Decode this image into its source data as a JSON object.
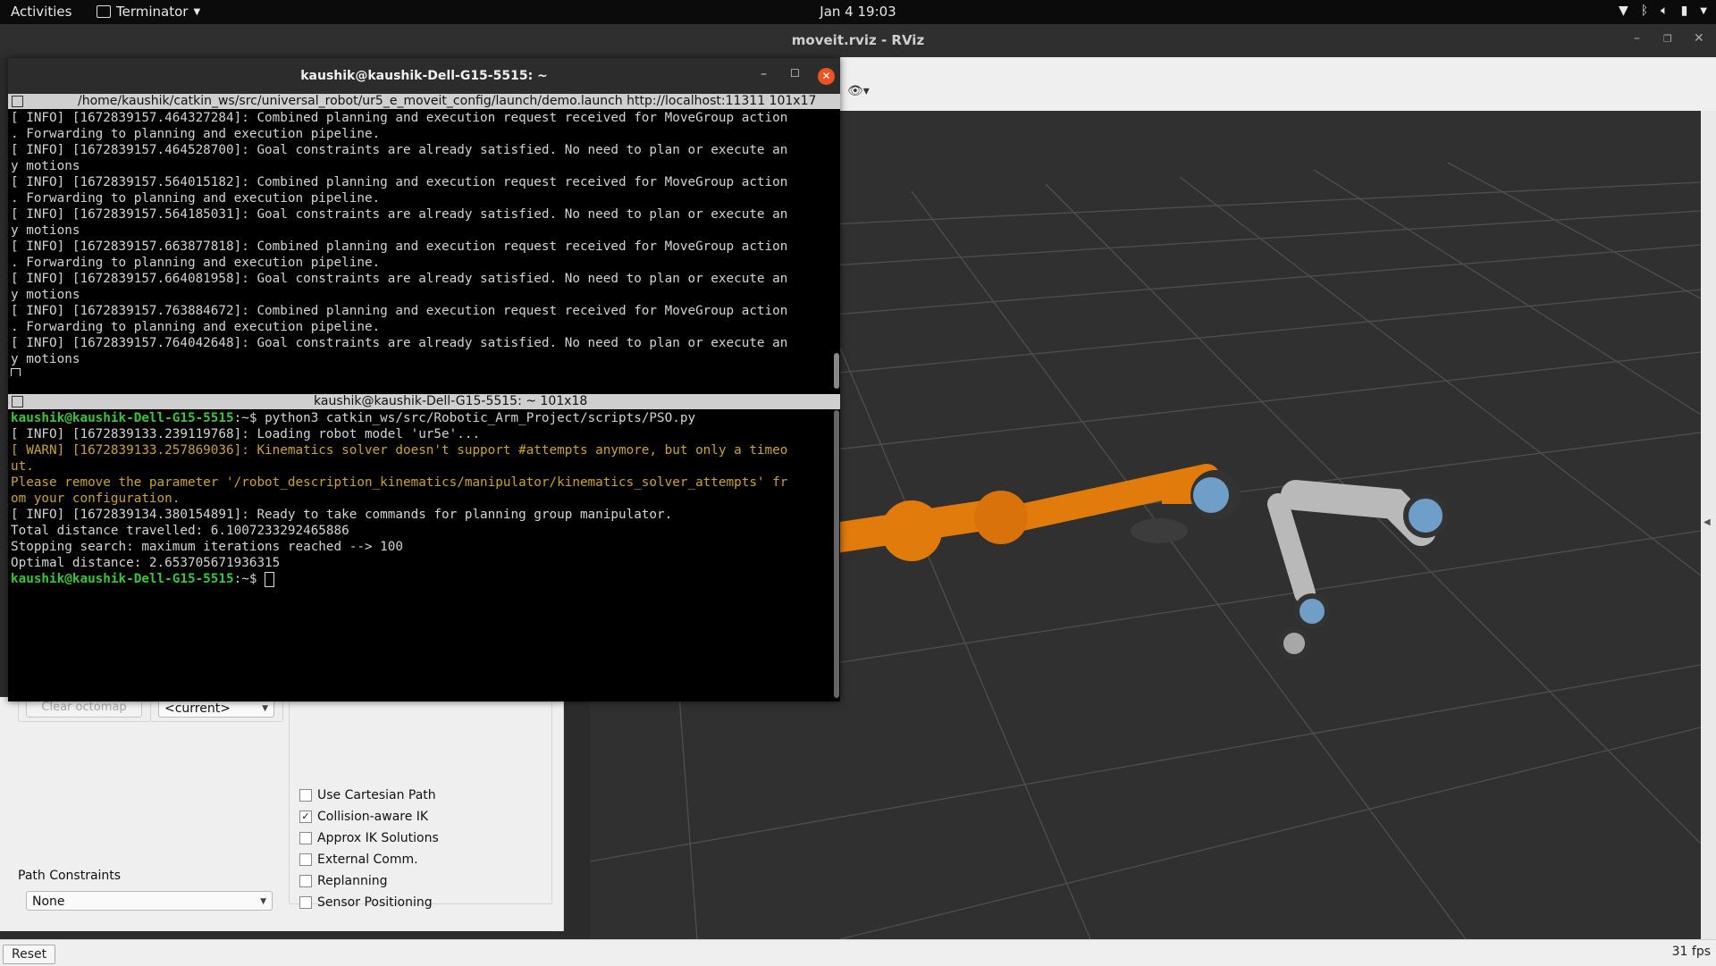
{
  "topbar": {
    "activities": "Activities",
    "app_menu": "Terminator",
    "clock": "Jan 4  19:03"
  },
  "rviz": {
    "title": "moveit.rviz - RViz",
    "fps": "31 fps",
    "reset_label": "Reset",
    "clear_octomap_label": "Clear octomap",
    "current_select": "<current>",
    "path_constraints_label": "Path Constraints",
    "path_constraints_value": "None",
    "options": [
      {
        "label": "Use Cartesian Path",
        "checked": false
      },
      {
        "label": "Collision-aware IK",
        "checked": true
      },
      {
        "label": "Approx IK Solutions",
        "checked": false
      },
      {
        "label": "External Comm.",
        "checked": false
      },
      {
        "label": "Replanning",
        "checked": false
      },
      {
        "label": "Sensor Positioning",
        "checked": false
      }
    ]
  },
  "terminal": {
    "window_title": "kaushik@kaushik-Dell-G15-5515: ~",
    "pane1_header": "/home/kaushik/catkin_ws/src/universal_robot/ur5_e_moveit_config/launch/demo.launch http://localhost:11311 101x17",
    "pane1_lines": [
      "[ INFO] [1672839157.464327284]: Combined planning and execution request received for MoveGroup action",
      ". Forwarding to planning and execution pipeline.",
      "[ INFO] [1672839157.464528700]: Goal constraints are already satisfied. No need to plan or execute an",
      "y motions",
      "[ INFO] [1672839157.564015182]: Combined planning and execution request received for MoveGroup action",
      ". Forwarding to planning and execution pipeline.",
      "[ INFO] [1672839157.564185031]: Goal constraints are already satisfied. No need to plan or execute an",
      "y motions",
      "[ INFO] [1672839157.663877818]: Combined planning and execution request received for MoveGroup action",
      ". Forwarding to planning and execution pipeline.",
      "[ INFO] [1672839157.664081958]: Goal constraints are already satisfied. No need to plan or execute an",
      "y motions",
      "[ INFO] [1672839157.763884672]: Combined planning and execution request received for MoveGroup action",
      ". Forwarding to planning and execution pipeline.",
      "[ INFO] [1672839157.764042648]: Goal constraints are already satisfied. No need to plan or execute an",
      "y motions"
    ],
    "pane2_header": "kaushik@kaushik-Dell-G15-5515: ~ 101x18",
    "prompt": "kaushik@kaushik-Dell-G15-5515",
    "prompt_suffix": ":~$ ",
    "command": "python3 catkin_ws/src/Robotic_Arm_Project/scripts/PSO.py",
    "pane2_lines": [
      {
        "text": "[ INFO] [1672839133.239119768]: Loading robot model 'ur5e'...",
        "style": "info"
      },
      {
        "text": "[ WARN] [1672839133.257869036]: Kinematics solver doesn't support #attempts anymore, but only a timeo",
        "style": "warn"
      },
      {
        "text": "ut.",
        "style": "warn"
      },
      {
        "text": "Please remove the parameter '/robot_description_kinematics/manipulator/kinematics_solver_attempts' fr",
        "style": "warn"
      },
      {
        "text": "om your configuration.",
        "style": "warn"
      },
      {
        "text": "[ INFO] [1672839134.380154891]: Ready to take commands for planning group manipulator.",
        "style": "info"
      },
      {
        "text": "Total distance travelled: 6.1007233292465886",
        "style": "info"
      },
      {
        "text": "Stopping search: maximum iterations reached --> 100",
        "style": "info"
      },
      {
        "text": "Optimal distance: 2.653705671936315",
        "style": "info"
      }
    ]
  },
  "colors": {
    "robot_orange": "#e07b0c",
    "robot_gray": "#b9b9b9",
    "joint_blue": "#6f9fc9",
    "prompt_green": "#3cc43c",
    "warn_yellow": "#c9a22f"
  }
}
